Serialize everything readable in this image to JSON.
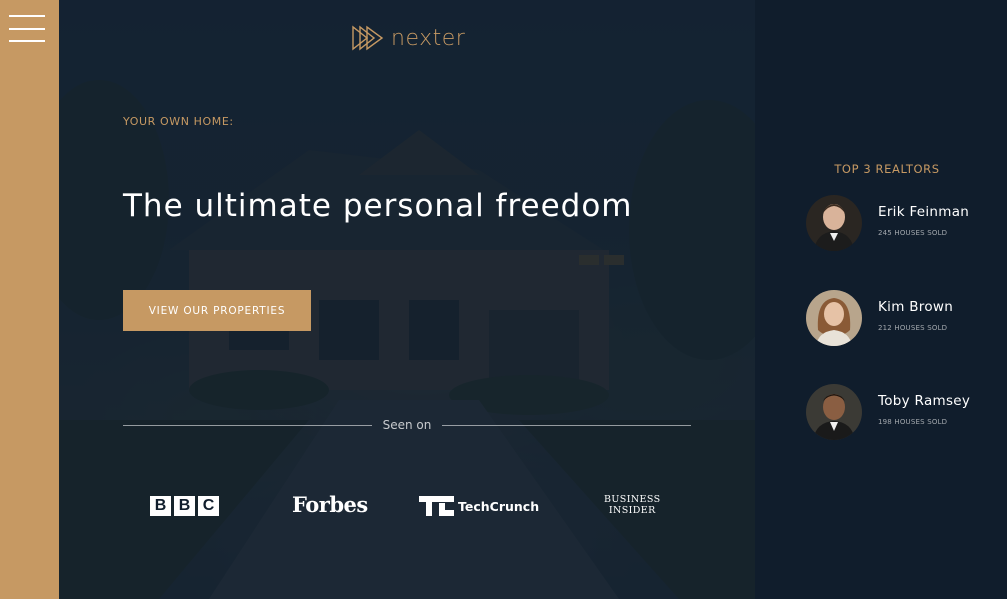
{
  "sidebar": {
    "menu_button": "hamburger-menu",
    "background_color": "#c69963"
  },
  "header": {
    "logo_text": "nexter",
    "subtitle": "YOUR OWN HOME:",
    "title": "The ultimate personal freedom",
    "cta_label": "VIEW OUR PROPERTIES",
    "seen_on_label": "Seen on",
    "press_logos": [
      {
        "name": "BBC",
        "letters": [
          "B",
          "B",
          "C"
        ]
      },
      {
        "name": "Forbes"
      },
      {
        "name": "TechCrunch"
      },
      {
        "name": "Business Insider",
        "line1": "BUSINESS",
        "line2": "INSIDER"
      }
    ]
  },
  "realtors": {
    "title": "TOP 3 REALTORS",
    "list": [
      {
        "name": "Erik Feinman",
        "sold": "245 HOUSES SOLD"
      },
      {
        "name": "Kim Brown",
        "sold": "212 HOUSES SOLD"
      },
      {
        "name": "Toby Ramsey",
        "sold": "198 HOUSES SOLD"
      }
    ]
  },
  "colors": {
    "primary": "#c69963",
    "dark": "#101d2c",
    "text_light": "#ffffff"
  }
}
